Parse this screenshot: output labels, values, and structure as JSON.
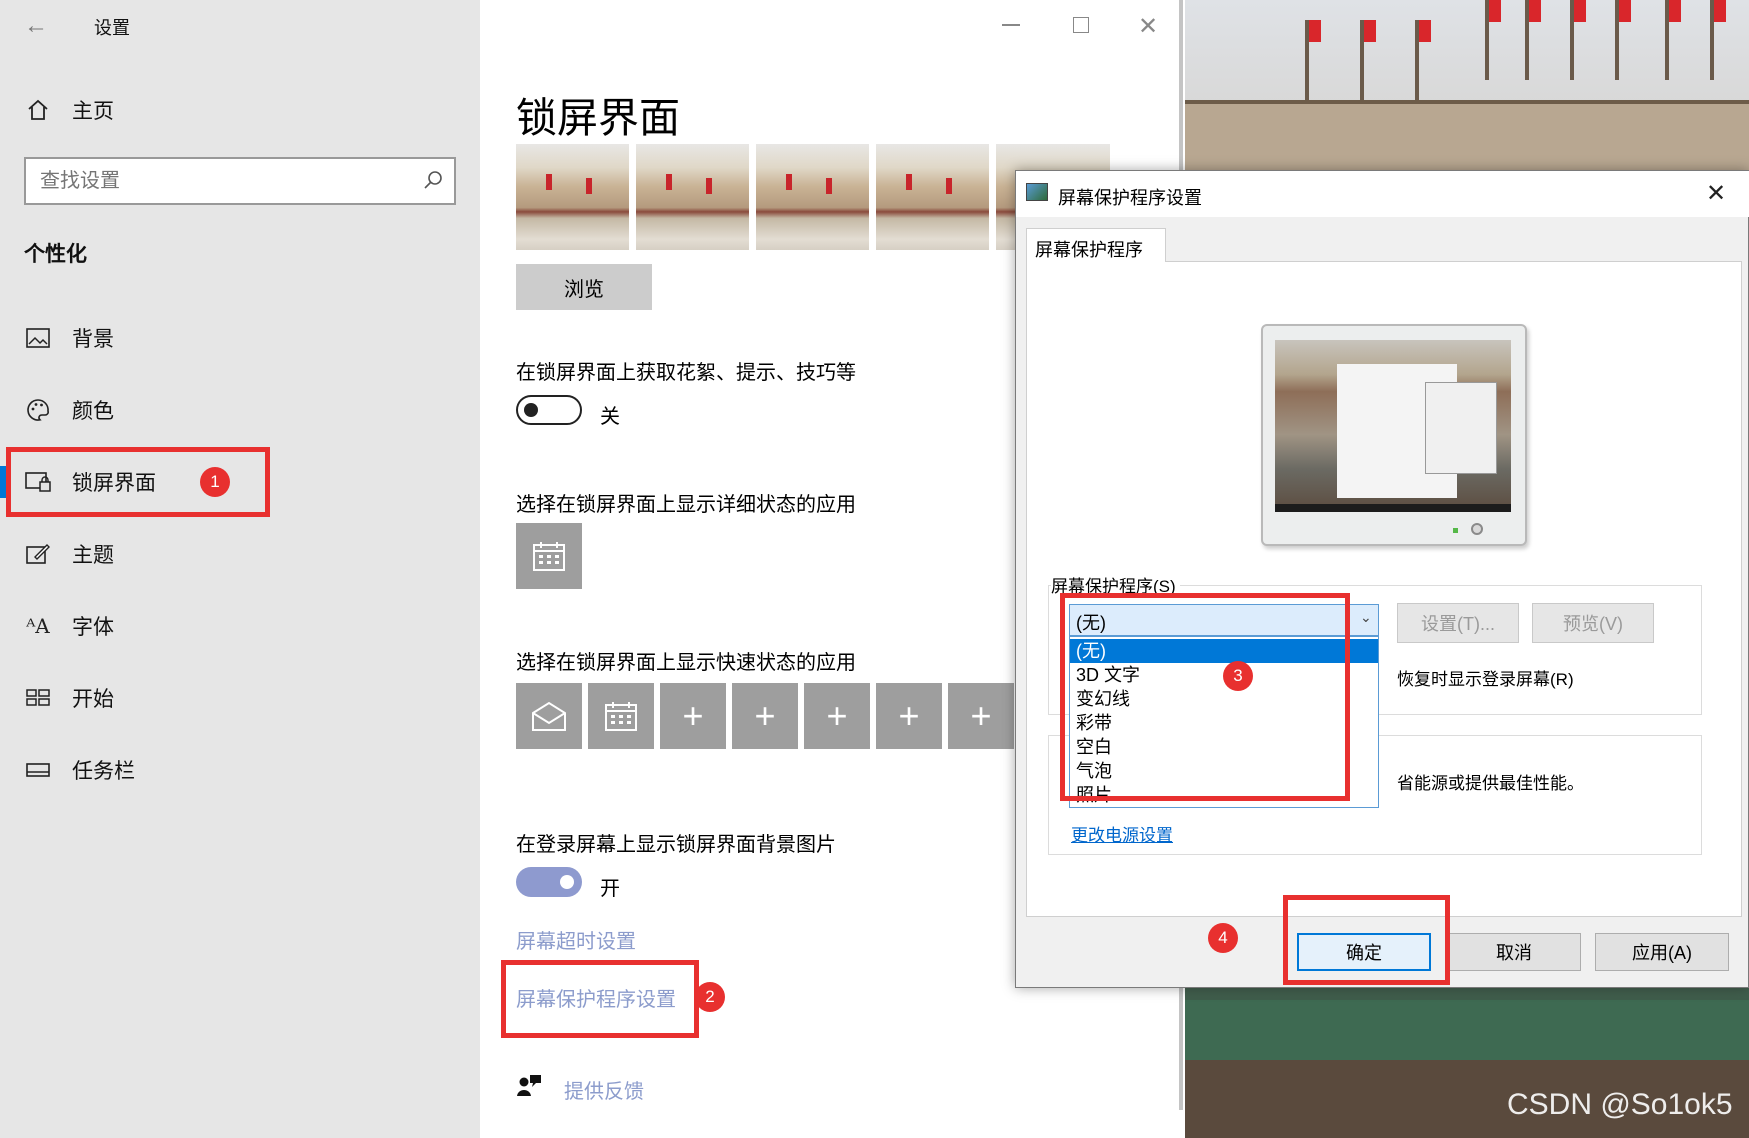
{
  "window": {
    "title": "设置",
    "back_icon": "back-arrow-icon"
  },
  "sidebar": {
    "home_label": "主页",
    "search_placeholder": "查找设置",
    "section_title": "个性化",
    "items": [
      {
        "label": "背景",
        "icon": "picture-icon"
      },
      {
        "label": "颜色",
        "icon": "palette-icon"
      },
      {
        "label": "锁屏界面",
        "icon": "lockscreen-icon",
        "selected": true
      },
      {
        "label": "主题",
        "icon": "theme-icon"
      },
      {
        "label": "字体",
        "icon": "font-icon"
      },
      {
        "label": "开始",
        "icon": "start-icon"
      },
      {
        "label": "任务栏",
        "icon": "taskbar-icon"
      }
    ]
  },
  "main": {
    "page_title": "锁屏界面",
    "browse_label": "浏览",
    "fun_facts_label": "在锁屏界面上获取花絮、提示、技巧等",
    "fun_facts_toggle_state": "关",
    "detailed_status_label": "选择在锁屏界面上显示详细状态的应用",
    "quick_status_label": "选择在锁屏界面上显示快速状态的应用",
    "signin_bg_label": "在登录屏幕上显示锁屏界面背景图片",
    "signin_bg_toggle_state": "开",
    "screen_timeout_link": "屏幕超时设置",
    "screensaver_link": "屏幕保护程序设置",
    "feedback_link": "提供反馈"
  },
  "dialog": {
    "title": "屏幕保护程序设置",
    "tab_label": "屏幕保护程序",
    "screensaver_group_label": "屏幕保护程序(S)",
    "selected_value": "(无)",
    "options": [
      "(无)",
      "3D 文字",
      "变幻线",
      "彩带",
      "空白",
      "气泡",
      "照片"
    ],
    "settings_button": "设置(T)...",
    "preview_button": "预览(V)",
    "resume_text": "恢复时显示登录屏幕(R)",
    "power_text": "省能源或提供最佳性能。",
    "change_power_link": "更改电源设置",
    "ok_button": "确定",
    "cancel_button": "取消",
    "apply_button": "应用(A)"
  },
  "annotations": [
    "1",
    "2",
    "3",
    "4"
  ],
  "watermark": "CSDN @So1ok5",
  "colors": {
    "accent": "#0078d7",
    "highlight_red": "#e8302f",
    "link": "#8c9ccc",
    "toggle_on": "#8e9acf"
  }
}
